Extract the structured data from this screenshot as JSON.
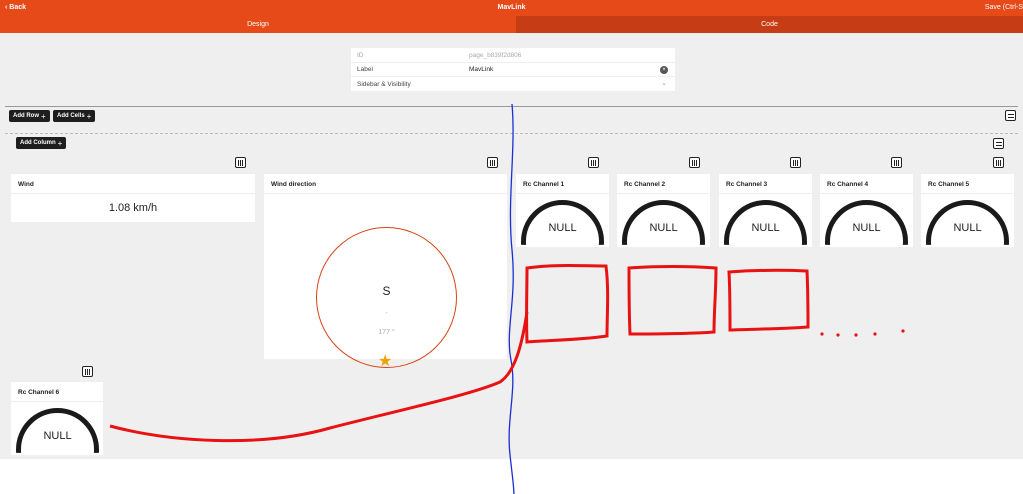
{
  "topbar": {
    "back_label": "Back",
    "title": "MavLink",
    "save_label": "Save (Ctrl-S"
  },
  "tabs": [
    {
      "label": "Design",
      "active": true
    },
    {
      "label": "Code",
      "active": false
    }
  ],
  "properties": {
    "id_label": "ID",
    "id_value": "page_b839f2d806",
    "label_label": "Label",
    "label_value": "MavLink",
    "sidebar_label": "Sidebar & Visibility"
  },
  "toolbar": {
    "add_row": "Add Row",
    "add_cells": "Add Cells",
    "add_column": "Add Column"
  },
  "widgets": {
    "wind": {
      "title": "Wind",
      "value": "1.08 km/h"
    },
    "wind_direction": {
      "title": "Wind direction",
      "direction": "S",
      "dash": "-",
      "degrees": "177 °"
    },
    "rc1": {
      "title": "Rc Channel 1",
      "value": "NULL"
    },
    "rc2": {
      "title": "Rc Channel 2",
      "value": "NULL"
    },
    "rc3": {
      "title": "Rc Channel 3",
      "value": "NULL"
    },
    "rc4": {
      "title": "Rc Channel 4",
      "value": "NULL"
    },
    "rc5": {
      "title": "Rc Channel 5",
      "value": "NULL"
    },
    "rc6": {
      "title": "Rc Channel 6",
      "value": "NULL"
    }
  },
  "icons": {
    "column_layout": "columns-icon",
    "row_layout": "rows-icon",
    "plus": "+",
    "clear": "×",
    "chevron": "⌄",
    "star": "★"
  },
  "colors": {
    "accent": "#e64a19",
    "tab_inactive": "#c63c14",
    "gauge": "#1a1a1a",
    "compass_ring": "#d84315",
    "annotation_red": "#e81212",
    "annotation_blue": "#1a2fd6",
    "star": "#f2a100"
  }
}
